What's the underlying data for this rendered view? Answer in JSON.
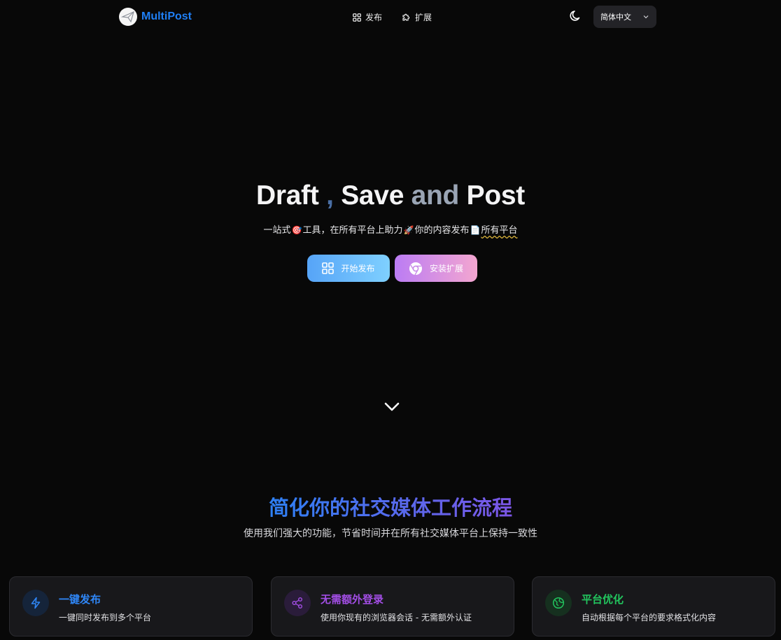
{
  "nav": {
    "brand": "MultiPost",
    "links": [
      {
        "label": "发布",
        "icon": "grid-icon"
      },
      {
        "label": "扩展",
        "icon": "puzzle-icon"
      }
    ],
    "theme_icon": "moon-icon",
    "language": "简体中文"
  },
  "hero": {
    "title_draft": "Draft",
    "title_comma": ",",
    "title_save": "Save",
    "title_and": "and",
    "title_post": "Post",
    "sub_1": "一站式",
    "sub_emoji_1": "🎯",
    "sub_2": "工具，在所有平台上助力",
    "sub_emoji_2": "🚀",
    "sub_3": "你的内容发布",
    "sub_emoji_3": "📄",
    "sub_4": "所有平台",
    "btn_start": "开始发布",
    "btn_extension": "安装扩展"
  },
  "features": {
    "title": "简化你的社交媒体工作流程",
    "subtitle": "使用我们强大的功能，节省时间并在所有社交媒体平台上保持一致性",
    "cards": [
      {
        "title": "一键发布",
        "desc": "一键同时发布到多个平台",
        "icon": "lightning-icon"
      },
      {
        "title": "无需额外登录",
        "desc": "使用你现有的浏览器会话 - 无需额外认证",
        "icon": "share-icon"
      },
      {
        "title": "平台优化",
        "desc": "自动根据每个平台的要求格式化内容",
        "icon": "globe-icon"
      }
    ]
  },
  "colors": {
    "brand": "#1f7ff5",
    "background": "#080808",
    "card_bg": "#18181b",
    "feature_blue": "#2f86f6",
    "feature_purple": "#a34ee6",
    "feature_green": "#22c55e"
  }
}
